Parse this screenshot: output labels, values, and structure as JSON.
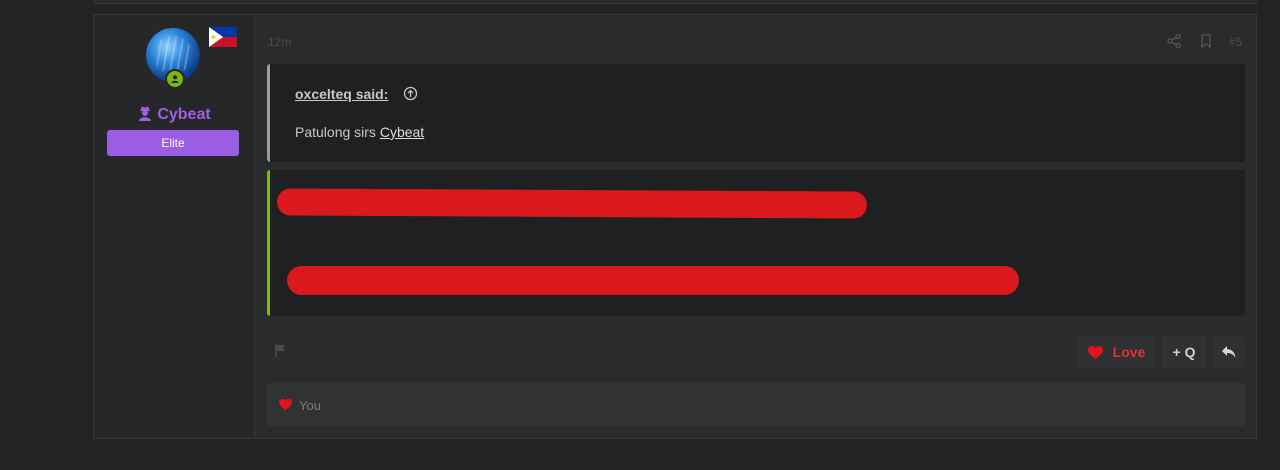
{
  "post": {
    "time": "12m",
    "number": "#5",
    "user": {
      "name": "Cybeat",
      "rank": "Elite",
      "flag_icon": "philippines-flag-icon",
      "status": "online"
    },
    "quote": {
      "author": "oxcelteq said:",
      "text_prefix": "Patulong sirs ",
      "mention": "Cybeat"
    },
    "actions": {
      "love_label": "Love",
      "quote_label": "+ Q",
      "reply_icon": "reply-icon"
    },
    "reactions": {
      "text": "You",
      "icon": "heart-icon"
    }
  },
  "colors": {
    "username": "#a05ee0",
    "rank_bg": "#9b5de5",
    "redaction": "#d9191c",
    "love": "#e03535",
    "online": "#7db512"
  }
}
